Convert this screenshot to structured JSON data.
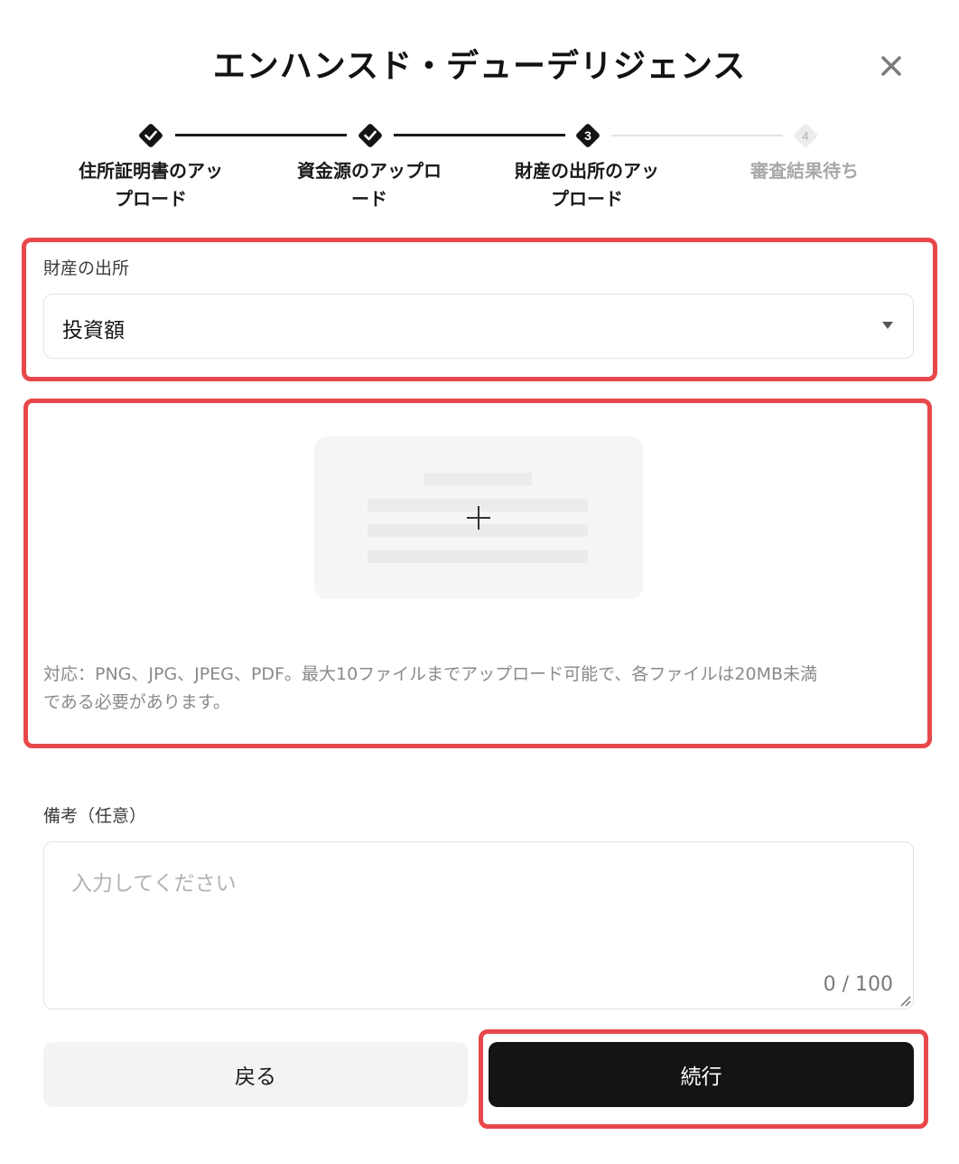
{
  "modal": {
    "title": "エンハンスド・デューデリジェンス"
  },
  "stepper": {
    "steps": [
      {
        "number": "",
        "label_line1": "住所証明書のアッ",
        "label_line2": "プロード",
        "status": "completed"
      },
      {
        "number": "",
        "label_line1": "資金源のアップロ",
        "label_line2": "ード",
        "status": "completed"
      },
      {
        "number": "3",
        "label_line1": "財産の出所のアッ",
        "label_line2": "プロード",
        "status": "current"
      },
      {
        "number": "4",
        "label_line1": "審査結果待ち",
        "label_line2": "",
        "status": "pending"
      }
    ]
  },
  "wealth_source": {
    "label": "財産の出所",
    "selected_value": "投資額"
  },
  "upload": {
    "note_line1": "対応：PNG、JPG、JPEG、PDF。最大10ファイルまでアップロード可能で、各ファイルは20MB未満",
    "note_line2": "である必要があります。"
  },
  "remarks": {
    "label": "備考（任意）",
    "placeholder": "入力してください",
    "value": "",
    "counter": "0 / 100"
  },
  "actions": {
    "back_label": "戻る",
    "continue_label": "続行"
  },
  "colors": {
    "highlight": "#e8484b",
    "primary_button": "#141414",
    "secondary_button": "#f2f3f5",
    "step_pending": "#e3e3e3"
  }
}
